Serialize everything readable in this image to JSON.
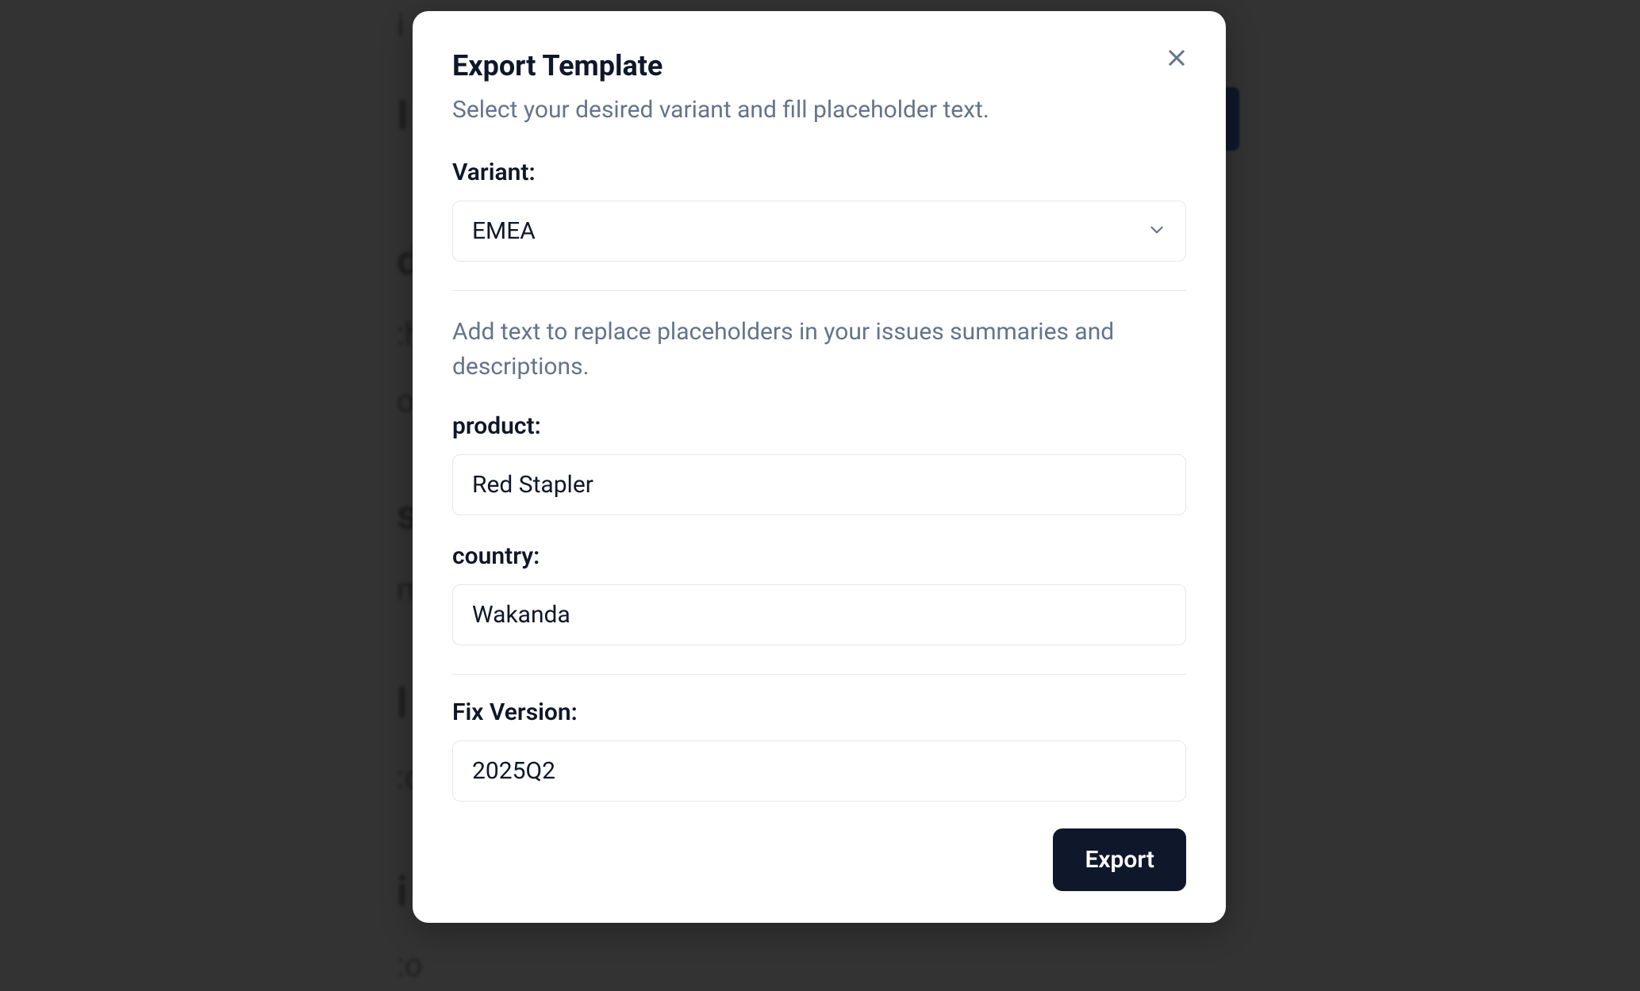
{
  "modal": {
    "title": "Export Template",
    "subtitle": "Select your desired variant and fill placeholder text.",
    "variant": {
      "label": "Variant:",
      "value": "EMEA"
    },
    "placeholders_description": "Add text to replace placeholders in your issues summaries and descriptions.",
    "fields": {
      "product": {
        "label": "product:",
        "value": "Red Stapler"
      },
      "country": {
        "label": "country:",
        "value": "Wakanda"
      },
      "fix_version": {
        "label": "Fix Version:",
        "value": "2025Q2"
      }
    },
    "export_button": "Export"
  }
}
